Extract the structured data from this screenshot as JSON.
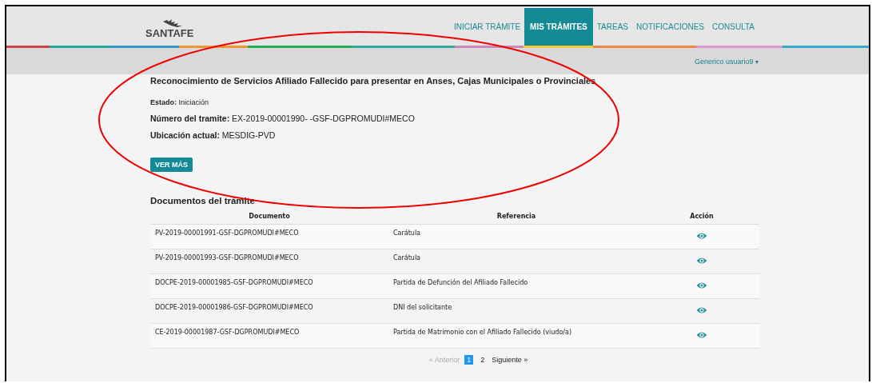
{
  "header": {
    "logo": "SANTAFE",
    "nav": [
      {
        "label": "INICIAR TRÁMITE",
        "selected": false
      },
      {
        "label": "MIS TRÁMITES",
        "selected": true
      },
      {
        "label": "TAREAS",
        "selected": false
      },
      {
        "label": "NOTIFICACIONES",
        "selected": false
      },
      {
        "label": "CONSULTA",
        "selected": false
      }
    ],
    "user": "Generico usuario9",
    "user_caret": "▾"
  },
  "tramite": {
    "title": "Reconocimiento de Servicios Afiliado Fallecido para presentar en Anses, Cajas Municipales o Provinciales",
    "estado_label": "Estado:",
    "estado": "Iniciación",
    "numero_label": "Número del tramite:",
    "numero": "EX-2019-00001990- -GSF-DGPROMUDI#MECO",
    "ubicacion_label": "Ubicación actual:",
    "ubicacion": "MESDIG-PVD",
    "button": "VER MÁS"
  },
  "documents": {
    "title": "Documentos del trámite",
    "columns": [
      "Documento",
      "Referencia",
      "Acción"
    ],
    "rows": [
      {
        "documento": "PV-2019-00001991-GSF-DGPROMUDI#MECO",
        "referencia": "Carátula"
      },
      {
        "documento": "PV-2019-00001993-GSF-DGPROMUDI#MECO",
        "referencia": "Carátula"
      },
      {
        "documento": "DOCPE-2019-00001985-GSF-DGPROMUDI#MECO",
        "referencia": "Partida de Defunción del Afiliado Fallecido"
      },
      {
        "documento": "DOCPE-2019-00001986-GSF-DGPROMUDI#MECO",
        "referencia": "DNI del solicitante"
      },
      {
        "documento": "CE-2019-00001987-GSF-DGPROMUDI#MECO",
        "referencia": "Partida de Matrimonio con el Afiliado Fallecido (viudo/a)"
      }
    ]
  },
  "pagination": {
    "prev": {
      "label": "« Anterior",
      "disabled": true
    },
    "pages": [
      {
        "label": "1",
        "selected": true
      },
      {
        "label": "2",
        "selected": false
      }
    ],
    "next": {
      "label": "Siguiente »",
      "disabled": false
    }
  }
}
